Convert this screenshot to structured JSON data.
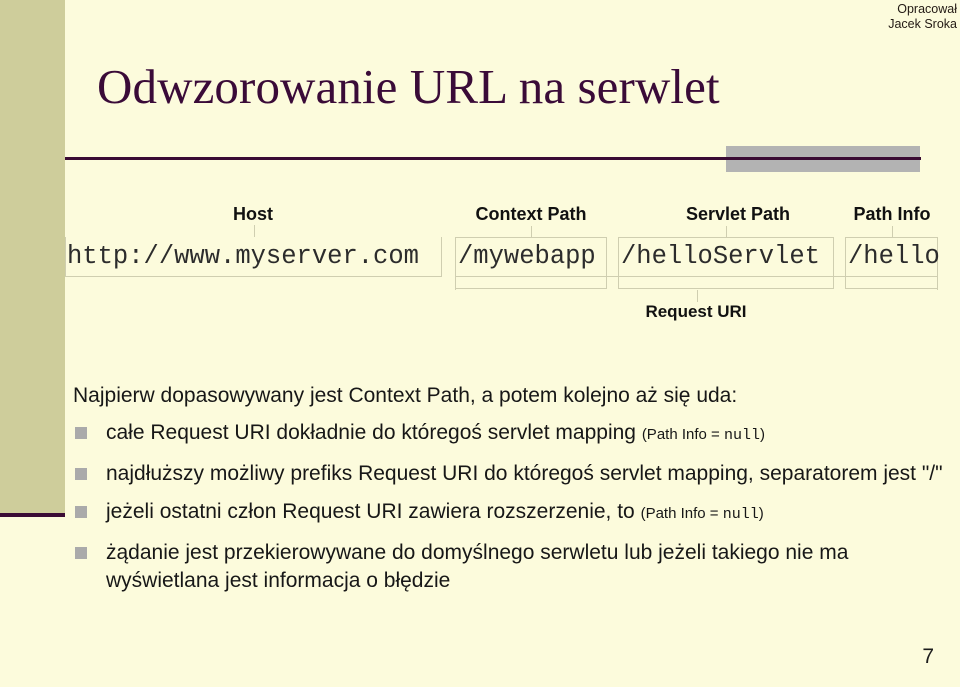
{
  "slide": {
    "credit": {
      "line1": "Opracował",
      "line2": "Jacek Sroka"
    },
    "title": "Odwzorowanie URL na serwlet",
    "page_number": "7",
    "colors": {
      "background": "#fcfbdc",
      "sidebar": "#cecd9b",
      "title": "#3a0b38",
      "rule": "#3a0b34",
      "gray_block": "#b3b3b3",
      "bracket": "#cfceb0",
      "bullet_marker": "#aaaaaa"
    }
  },
  "diagram": {
    "segments": [
      {
        "label": "Host",
        "value": "http://www.myserver.com"
      },
      {
        "label": "Context Path",
        "value": "/mywebapp"
      },
      {
        "label": "Servlet Path",
        "value": "/helloServlet"
      },
      {
        "label": "Path Info",
        "value": "/hello"
      }
    ],
    "request_uri_label": "Request URI"
  },
  "content": {
    "lead": "Najpierw dopasowywany jest Context Path, a potem kolejno aż się uda:",
    "bullets": [
      {
        "text": "całe Request URI dokładnie do któregoś servlet mapping ",
        "note_prefix": "(Path Info = ",
        "note_mono": "null",
        "note_suffix": ")"
      },
      {
        "text": "najdłuższy możliwy prefiks Request URI do któregoś servlet mapping, separatorem jest \"/\"",
        "note_prefix": "",
        "note_mono": "",
        "note_suffix": ""
      },
      {
        "text": "jeżeli ostatni człon Request URI zawiera rozszerzenie, to ",
        "note_prefix": "(Path Info = ",
        "note_mono": "null",
        "note_suffix": ")"
      },
      {
        "text": "żądanie jest przekierowywane do domyślnego serwletu lub jeżeli takiego nie ma wyświetlana jest informacja o błędzie",
        "note_prefix": "",
        "note_mono": "",
        "note_suffix": ""
      }
    ]
  }
}
